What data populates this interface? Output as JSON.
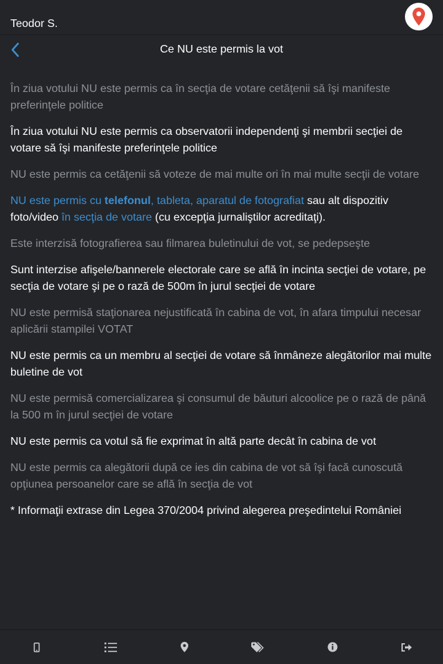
{
  "header": {
    "user_name": "Teodor S.",
    "title": "Ce NU este permis la vot"
  },
  "paragraphs": [
    "În ziua votului NU este permis ca în secţia de votare cetăţenii să îşi manifeste preferinţele politice",
    "În ziua votului NU este permis ca observatorii independenţi şi membrii secţiei de votare să îşi manifeste preferinţele politice",
    "NU este permis ca cetăţenii să voteze de mai multe ori în mai multe secţii de votare",
    {
      "link1": "NU este permis cu ",
      "link_bold": "telefonul",
      "link2": ", tableta, aparatul de fotografiat",
      "text1": " sau alt dispozitiv foto/video ",
      "link3": "în secţia de votare",
      "text2": " (cu excepţia jurnaliştilor acreditaţi)."
    },
    "Este interzisă fotografierea sau filmarea buletinului de vot, se pedepseşte",
    "Sunt interzise afişele/bannerele electorale care se află în incinta secţiei de votare, pe secţia de votare şi pe o rază de 500m în jurul secţiei de votare",
    "NU este permisă staţionarea nejustificată în cabina de vot, în afara timpului necesar aplicării stampilei VOTAT",
    "NU este permis ca un membru al secţiei de votare să înmâneze alegătorilor mai multe buletine de vot",
    "NU este permisă comercializarea şi consumul de băuturi alcoolice pe o rază de până la 500 m în jurul secţiei de votare",
    "NU este permis ca votul să fie exprimat în altă parte decât în cabina de vot",
    "NU este permis ca alegătorii după ce ies din cabina de vot să îşi facă cunoscută opţiunea persoanelor care se află în secţia de vot",
    "* Informaţii extrase din Legea 370/2004 privind alegerea preşedintelui României"
  ],
  "tabs": [
    {
      "icon": "mobile-icon"
    },
    {
      "icon": "list-icon"
    },
    {
      "icon": "map-marker-icon"
    },
    {
      "icon": "tags-icon"
    },
    {
      "icon": "info-icon"
    },
    {
      "icon": "sign-out-icon"
    }
  ],
  "colors": {
    "background": "#232529",
    "text_dim": "#8e9197",
    "text_bright": "#ffffff",
    "link": "#3d8fd1",
    "pin": "#e74c3c",
    "back_arrow": "#3d8fd1"
  }
}
